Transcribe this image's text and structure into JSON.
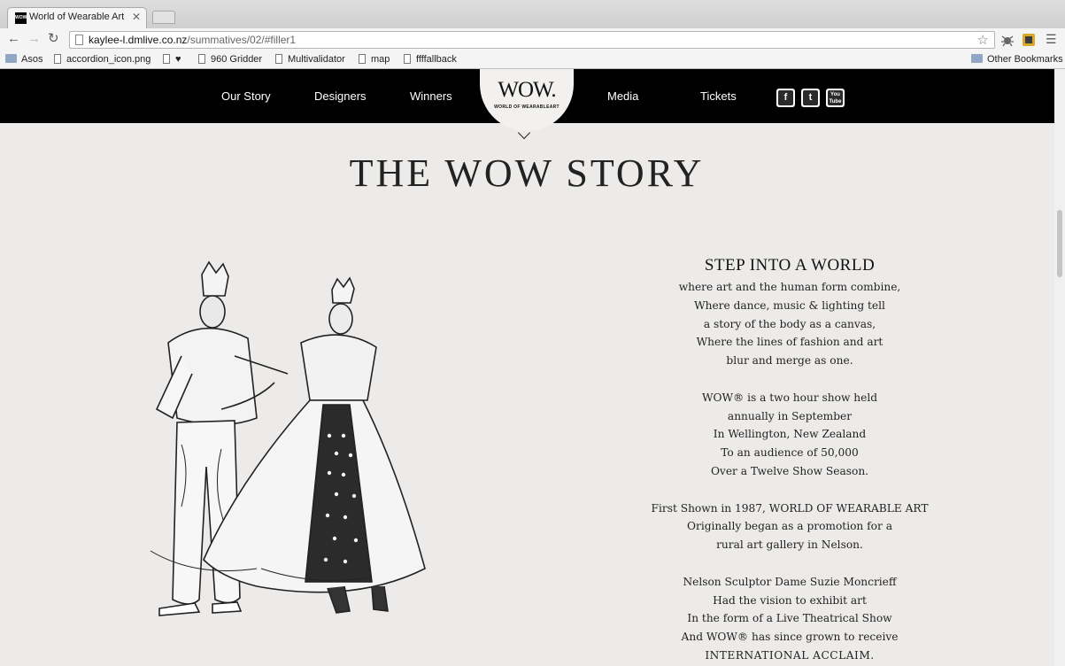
{
  "browser": {
    "tab_title": "World of Wearable Art",
    "url_host": "kaylee-l.dmlive.co.nz",
    "url_path": "/summatives/02/#filler1",
    "bookmarks": [
      {
        "label": "Asos",
        "type": "folder"
      },
      {
        "label": "accordion_icon.png",
        "type": "page"
      },
      {
        "label": "♥",
        "type": "page"
      },
      {
        "label": "960 Gridder",
        "type": "page"
      },
      {
        "label": "Multivalidator",
        "type": "page"
      },
      {
        "label": "map",
        "type": "page"
      },
      {
        "label": "ffffallback",
        "type": "page"
      }
    ],
    "other_bookmarks": "Other Bookmarks"
  },
  "nav": {
    "links": [
      "Our Story",
      "Designers",
      "Winners",
      "Media",
      "Tickets"
    ],
    "logo": "WOW.",
    "logo_sub": "WORLD OF WEARABLEART",
    "social": [
      {
        "label": "f",
        "icon": "facebook-icon"
      },
      {
        "label": "t",
        "icon": "twitter-icon"
      },
      {
        "label": "You Tube",
        "icon": "youtube-icon"
      }
    ]
  },
  "main": {
    "headline": "THE WOW STORY",
    "step_heading": "STEP INTO A WORLD",
    "paragraphs": [
      [
        "where art and the human form combine,",
        "Where dance, music & lighting tell",
        "a story of the body as a canvas,",
        "Where the lines of fashion and art",
        "blur and merge as one."
      ],
      [
        "WOW® is a two hour show held",
        "annually in September",
        "In Wellington, New Zealand",
        "To an audience of 50,000",
        "Over a Twelve Show Season."
      ],
      [
        "First Shown in 1987, WORLD OF WEARABLE ART",
        "Originally began as a promotion for a",
        "rural art gallery in Nelson."
      ],
      [
        "Nelson Sculptor Dame Suzie Moncrieff",
        "Had the vision to exhibit art",
        "In the form of a Live Theatrical Show",
        "And WOW® has since grown to receive",
        "INTERNATIONAL ACCLAIM."
      ]
    ]
  }
}
